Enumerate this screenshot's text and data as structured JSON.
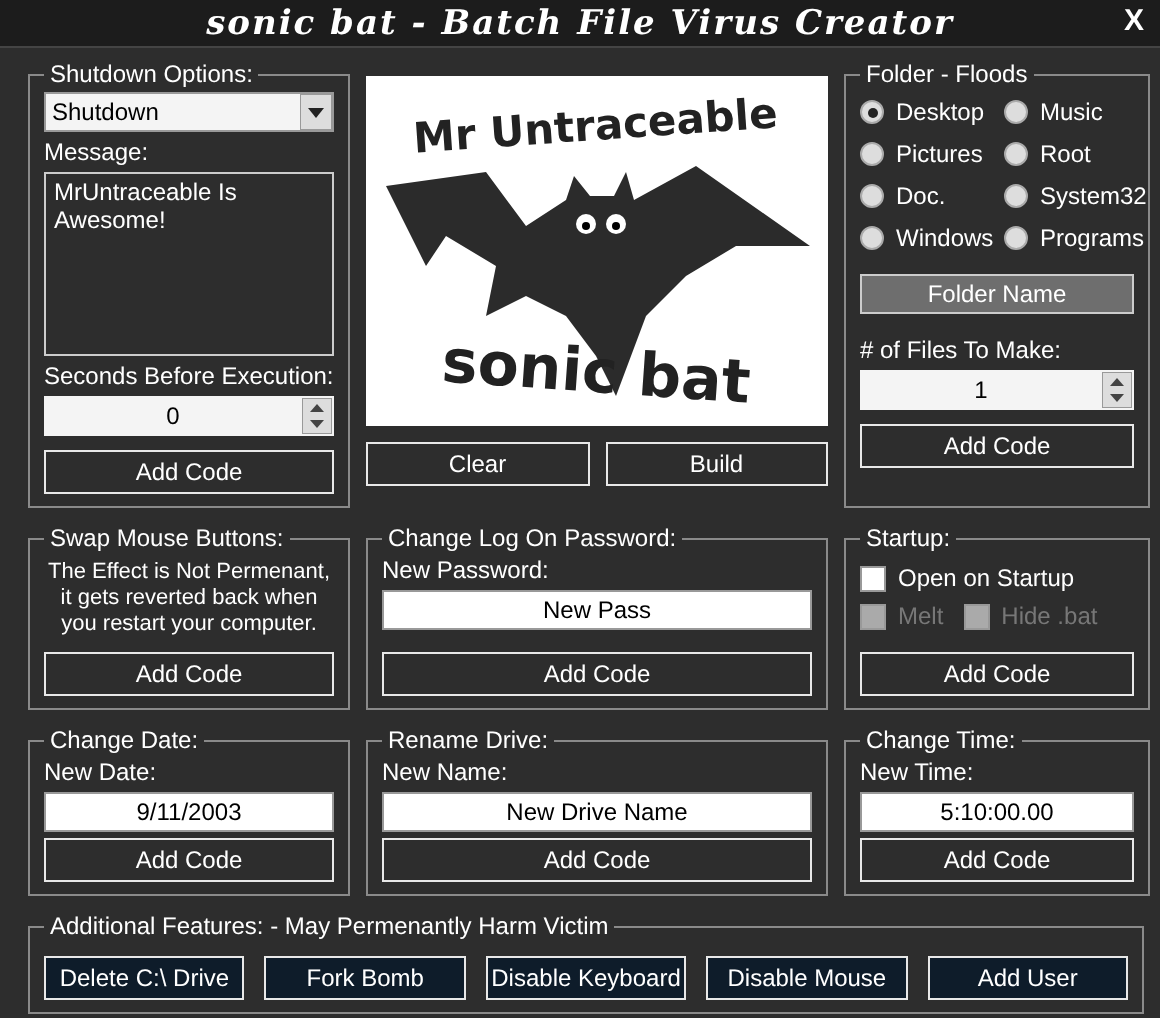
{
  "window": {
    "title": "sonic bat - Batch File Virus Creator",
    "close": "X"
  },
  "shutdown": {
    "title": "Shutdown Options:",
    "mode": "Shutdown",
    "message_label": "Message:",
    "message": "MrUntraceable Is Awesome!",
    "seconds_label": "Seconds Before Execution:",
    "seconds": "0",
    "button": "Add Code"
  },
  "logo": {
    "top": "Mr Untraceable",
    "bottom": "sonic bat"
  },
  "actions": [
    "Clear",
    "Build"
  ],
  "floods": {
    "title": "Folder - Floods",
    "options": [
      {
        "label": "Desktop",
        "selected": true
      },
      {
        "label": "Music",
        "selected": false
      },
      {
        "label": "Pictures",
        "selected": false
      },
      {
        "label": "Root",
        "selected": false
      },
      {
        "label": "Doc.",
        "selected": false
      },
      {
        "label": "System32",
        "selected": false
      },
      {
        "label": "Windows",
        "selected": false
      },
      {
        "label": "Programs",
        "selected": false
      }
    ],
    "folder_name": "Folder Name",
    "count_label": "# of Files To Make:",
    "count": "1",
    "button": "Add Code"
  },
  "panels": [
    {
      "kind": "note",
      "title": "Swap Mouse Buttons:",
      "text": "The Effect is Not Permenant, it gets reverted back when you restart your computer.",
      "button": "Add Code"
    },
    {
      "kind": "field",
      "title": "Change Log On Password:",
      "label": "New Password:",
      "value": "New Pass",
      "button": "Add Code"
    },
    {
      "kind": "checks",
      "title": "Startup:",
      "checks": [
        {
          "label": "Open on Startup",
          "checked": false,
          "disabled": false
        },
        {
          "label": "Melt",
          "checked": false,
          "disabled": true
        },
        {
          "label": "Hide .bat",
          "checked": false,
          "disabled": true
        }
      ],
      "button": "Add Code"
    },
    {
      "kind": "field",
      "title": "Change Date:",
      "label": "New Date:",
      "value": "9/11/2003",
      "button": "Add Code"
    },
    {
      "kind": "field",
      "title": "Rename Drive:",
      "label": "New Name:",
      "value": "New Drive Name",
      "button": "Add Code"
    },
    {
      "kind": "field",
      "title": "Change Time:",
      "label": "New Time:",
      "value": "5:10:00.00",
      "button": "Add Code"
    }
  ],
  "additional": {
    "title": "Additional Features:",
    "warning": "- May Permenantly Harm Victim",
    "buttons": [
      "Delete C:\\ Drive",
      "Fork Bomb",
      "Disable Keyboard",
      "Disable Mouse",
      "Add User"
    ]
  }
}
